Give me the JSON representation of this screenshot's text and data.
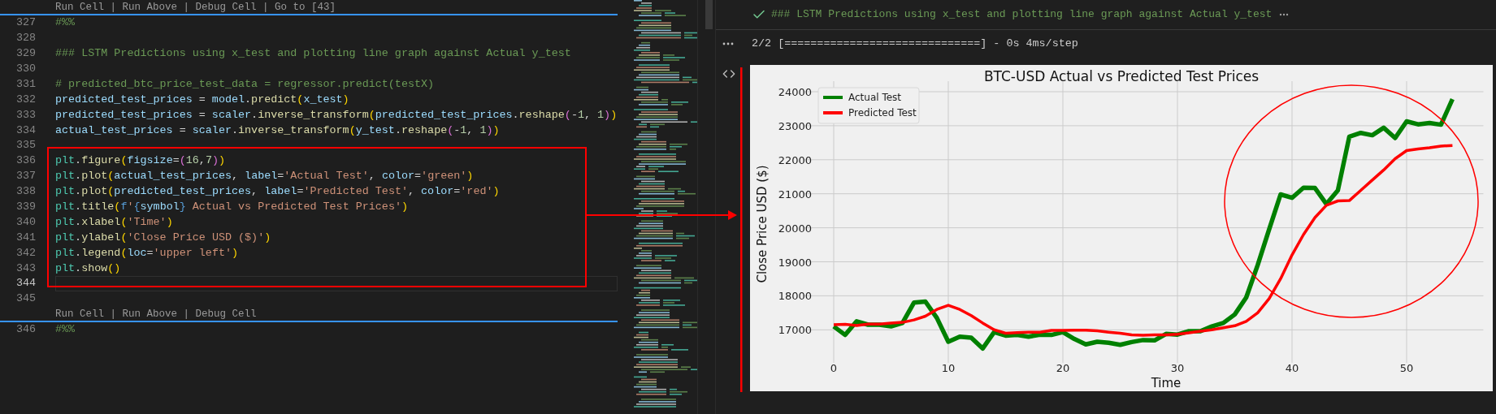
{
  "editor": {
    "rows": [
      {
        "kind": "codelens",
        "text": "Run Cell | Run Above | Debug Cell | Go to [43]"
      },
      {
        "kind": "code",
        "number": "327",
        "current": false,
        "tokens": [
          {
            "kind": "comment",
            "text": "#%%"
          }
        ]
      },
      {
        "kind": "code",
        "number": "328",
        "current": false
      },
      {
        "kind": "code",
        "number": "329",
        "current": false,
        "tokens": [
          {
            "kind": "comment",
            "text": "### LSTM Predictions using x_test and plotting line graph against Actual y_test"
          }
        ]
      },
      {
        "kind": "code",
        "number": "330",
        "current": false
      },
      {
        "kind": "code",
        "number": "331",
        "current": false,
        "tokens": [
          {
            "kind": "comment",
            "text": "# predicted_btc_price_test_data = regressor.predict(testX)"
          }
        ]
      },
      {
        "kind": "code",
        "number": "332",
        "current": false,
        "tokens": [
          {
            "kind": "variable",
            "text": "predicted_test_prices"
          },
          {
            "kind": "punct",
            "text": " = "
          },
          {
            "kind": "variable",
            "text": "model"
          },
          {
            "kind": "punct",
            "text": "."
          },
          {
            "kind": "function",
            "text": "predict"
          },
          {
            "kind": "bracket1",
            "text": "("
          },
          {
            "kind": "variable",
            "text": "x_test"
          },
          {
            "kind": "bracket1",
            "text": ")"
          }
        ]
      },
      {
        "kind": "code",
        "number": "333",
        "current": false,
        "tokens": [
          {
            "kind": "variable",
            "text": "predicted_test_prices"
          },
          {
            "kind": "punct",
            "text": " = "
          },
          {
            "kind": "variable",
            "text": "scaler"
          },
          {
            "kind": "punct",
            "text": "."
          },
          {
            "kind": "function",
            "text": "inverse_transform"
          },
          {
            "kind": "bracket1",
            "text": "("
          },
          {
            "kind": "variable",
            "text": "predicted_test_prices"
          },
          {
            "kind": "punct",
            "text": "."
          },
          {
            "kind": "function",
            "text": "reshape"
          },
          {
            "kind": "bracket2",
            "text": "("
          },
          {
            "kind": "punct",
            "text": "-"
          },
          {
            "kind": "number",
            "text": "1"
          },
          {
            "kind": "punct",
            "text": ", "
          },
          {
            "kind": "number",
            "text": "1"
          },
          {
            "kind": "bracket2",
            "text": ")"
          },
          {
            "kind": "bracket1",
            "text": ")"
          }
        ]
      },
      {
        "kind": "code",
        "number": "334",
        "current": false,
        "tokens": [
          {
            "kind": "variable",
            "text": "actual_test_prices"
          },
          {
            "kind": "punct",
            "text": " = "
          },
          {
            "kind": "variable",
            "text": "scaler"
          },
          {
            "kind": "punct",
            "text": "."
          },
          {
            "kind": "function",
            "text": "inverse_transform"
          },
          {
            "kind": "bracket1",
            "text": "("
          },
          {
            "kind": "variable",
            "text": "y_test"
          },
          {
            "kind": "punct",
            "text": "."
          },
          {
            "kind": "function",
            "text": "reshape"
          },
          {
            "kind": "bracket2",
            "text": "("
          },
          {
            "kind": "punct",
            "text": "-"
          },
          {
            "kind": "number",
            "text": "1"
          },
          {
            "kind": "punct",
            "text": ", "
          },
          {
            "kind": "number",
            "text": "1"
          },
          {
            "kind": "bracket2",
            "text": ")"
          },
          {
            "kind": "bracket1",
            "text": ")"
          }
        ]
      },
      {
        "kind": "code",
        "number": "335",
        "current": false
      },
      {
        "kind": "code",
        "number": "336",
        "current": false,
        "tokens": [
          {
            "kind": "module",
            "text": "plt"
          },
          {
            "kind": "punct",
            "text": "."
          },
          {
            "kind": "function",
            "text": "figure"
          },
          {
            "kind": "bracket1",
            "text": "("
          },
          {
            "kind": "variable",
            "text": "figsize"
          },
          {
            "kind": "punct",
            "text": "="
          },
          {
            "kind": "bracket2",
            "text": "("
          },
          {
            "kind": "number",
            "text": "16"
          },
          {
            "kind": "punct",
            "text": ","
          },
          {
            "kind": "number",
            "text": "7"
          },
          {
            "kind": "bracket2",
            "text": ")"
          },
          {
            "kind": "bracket1",
            "text": ")"
          }
        ]
      },
      {
        "kind": "code",
        "number": "337",
        "current": false,
        "tokens": [
          {
            "kind": "module",
            "text": "plt"
          },
          {
            "kind": "punct",
            "text": "."
          },
          {
            "kind": "function",
            "text": "plot"
          },
          {
            "kind": "bracket1",
            "text": "("
          },
          {
            "kind": "variable",
            "text": "actual_test_prices"
          },
          {
            "kind": "punct",
            "text": ", "
          },
          {
            "kind": "variable",
            "text": "label"
          },
          {
            "kind": "punct",
            "text": "="
          },
          {
            "kind": "string",
            "text": "'Actual Test'"
          },
          {
            "kind": "punct",
            "text": ", "
          },
          {
            "kind": "variable",
            "text": "color"
          },
          {
            "kind": "punct",
            "text": "="
          },
          {
            "kind": "string",
            "text": "'green'"
          },
          {
            "kind": "bracket1",
            "text": ")"
          }
        ]
      },
      {
        "kind": "code",
        "number": "338",
        "current": false,
        "tokens": [
          {
            "kind": "module",
            "text": "plt"
          },
          {
            "kind": "punct",
            "text": "."
          },
          {
            "kind": "function",
            "text": "plot"
          },
          {
            "kind": "bracket1",
            "text": "("
          },
          {
            "kind": "variable",
            "text": "predicted_test_prices"
          },
          {
            "kind": "punct",
            "text": ", "
          },
          {
            "kind": "variable",
            "text": "label"
          },
          {
            "kind": "punct",
            "text": "="
          },
          {
            "kind": "string",
            "text": "'Predicted Test'"
          },
          {
            "kind": "punct",
            "text": ", "
          },
          {
            "kind": "variable",
            "text": "color"
          },
          {
            "kind": "punct",
            "text": "="
          },
          {
            "kind": "string",
            "text": "'red'"
          },
          {
            "kind": "bracket1",
            "text": ")"
          }
        ]
      },
      {
        "kind": "code",
        "number": "339",
        "current": false,
        "tokens": [
          {
            "kind": "module",
            "text": "plt"
          },
          {
            "kind": "punct",
            "text": "."
          },
          {
            "kind": "function",
            "text": "title"
          },
          {
            "kind": "bracket1",
            "text": "("
          },
          {
            "kind": "keyword",
            "text": "f"
          },
          {
            "kind": "string",
            "text": "'"
          },
          {
            "kind": "keyword",
            "text": "{"
          },
          {
            "kind": "variable",
            "text": "symbol"
          },
          {
            "kind": "keyword",
            "text": "}"
          },
          {
            "kind": "string",
            "text": " Actual vs Predicted Test Prices'"
          },
          {
            "kind": "bracket1",
            "text": ")"
          }
        ]
      },
      {
        "kind": "code",
        "number": "340",
        "current": false,
        "tokens": [
          {
            "kind": "module",
            "text": "plt"
          },
          {
            "kind": "punct",
            "text": "."
          },
          {
            "kind": "function",
            "text": "xlabel"
          },
          {
            "kind": "bracket1",
            "text": "("
          },
          {
            "kind": "string",
            "text": "'Time'"
          },
          {
            "kind": "bracket1",
            "text": ")"
          }
        ]
      },
      {
        "kind": "code",
        "number": "341",
        "current": false,
        "tokens": [
          {
            "kind": "module",
            "text": "plt"
          },
          {
            "kind": "punct",
            "text": "."
          },
          {
            "kind": "function",
            "text": "ylabel"
          },
          {
            "kind": "bracket1",
            "text": "("
          },
          {
            "kind": "string",
            "text": "'Close Price USD ($)'"
          },
          {
            "kind": "bracket1",
            "text": ")"
          }
        ]
      },
      {
        "kind": "code",
        "number": "342",
        "current": false,
        "tokens": [
          {
            "kind": "module",
            "text": "plt"
          },
          {
            "kind": "punct",
            "text": "."
          },
          {
            "kind": "function",
            "text": "legend"
          },
          {
            "kind": "bracket1",
            "text": "("
          },
          {
            "kind": "variable",
            "text": "loc"
          },
          {
            "kind": "punct",
            "text": "="
          },
          {
            "kind": "string",
            "text": "'upper left'"
          },
          {
            "kind": "bracket1",
            "text": ")"
          }
        ]
      },
      {
        "kind": "code",
        "number": "343",
        "current": false,
        "tokens": [
          {
            "kind": "module",
            "text": "plt"
          },
          {
            "kind": "punct",
            "text": "."
          },
          {
            "kind": "function",
            "text": "show"
          },
          {
            "kind": "bracket1",
            "text": "()"
          }
        ]
      },
      {
        "kind": "code",
        "number": "344",
        "current": true
      },
      {
        "kind": "code",
        "number": "345",
        "current": false
      },
      {
        "kind": "codelens",
        "text": "Run Cell | Run Above | Debug Cell"
      },
      {
        "kind": "code",
        "number": "346",
        "current": false,
        "tokens": [
          {
            "kind": "comment",
            "text": "#%%"
          }
        ]
      }
    ]
  },
  "output": {
    "cell_title": "### LSTM Predictions using x_test and plotting line graph against Actual y_test",
    "progress": "2/2 [==============================] - 0s 4ms/step",
    "chart_data": {
      "type": "line",
      "title": "BTC-USD Actual vs Predicted Test Prices",
      "xlabel": "Time",
      "ylabel": "Close Price USD ($)",
      "x": [
        0,
        1,
        2,
        3,
        4,
        5,
        6,
        7,
        8,
        9,
        10,
        11,
        12,
        13,
        14,
        15,
        16,
        17,
        18,
        19,
        20,
        21,
        22,
        23,
        24,
        25,
        26,
        27,
        28,
        29,
        30,
        31,
        32,
        33,
        34,
        35,
        36,
        37,
        38,
        39,
        40,
        41,
        42,
        43,
        44,
        45,
        46,
        47,
        48,
        49,
        50,
        51,
        52,
        53,
        54
      ],
      "series": [
        {
          "name": "Actual Test",
          "color": "#008000",
          "values": [
            17100,
            16850,
            17250,
            17150,
            17150,
            17100,
            17200,
            17800,
            17830,
            17350,
            16650,
            16800,
            16770,
            16450,
            16930,
            16830,
            16850,
            16800,
            16860,
            16850,
            16930,
            16730,
            16570,
            16650,
            16620,
            16560,
            16640,
            16700,
            16690,
            16880,
            16860,
            16960,
            16960,
            17100,
            17200,
            17450,
            17950,
            18900,
            19950,
            20980,
            20880,
            21180,
            21170,
            20700,
            21100,
            22680,
            22790,
            22720,
            22940,
            22640,
            23130,
            23040,
            23080,
            23030,
            23780
          ]
        },
        {
          "name": "Predicted Test",
          "color": "#ff0000",
          "values": [
            17150,
            17160,
            17130,
            17170,
            17170,
            17200,
            17220,
            17290,
            17400,
            17600,
            17720,
            17600,
            17420,
            17200,
            17000,
            16900,
            16920,
            16930,
            16930,
            16980,
            16980,
            16990,
            16990,
            16970,
            16930,
            16900,
            16850,
            16840,
            16850,
            16850,
            16870,
            16910,
            16960,
            17000,
            17060,
            17120,
            17250,
            17500,
            17920,
            18500,
            19200,
            19800,
            20300,
            20660,
            20790,
            20800,
            21100,
            21400,
            21700,
            22030,
            22270,
            22320,
            22350,
            22400,
            22420
          ]
        }
      ],
      "xlim": [
        -2.7,
        56.7
      ],
      "ylim": [
        16030,
        24310
      ],
      "xticks": [
        0,
        10,
        20,
        30,
        40,
        50
      ],
      "yticks": [
        17000,
        18000,
        19000,
        20000,
        21000,
        22000,
        23000,
        24000
      ],
      "grid": true,
      "legend": true
    }
  }
}
